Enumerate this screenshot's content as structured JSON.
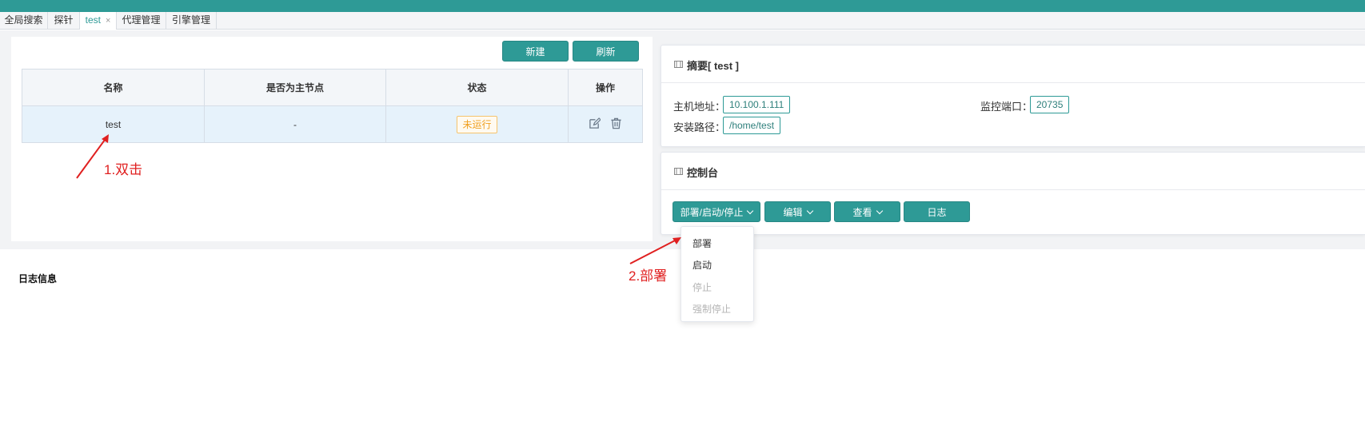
{
  "tabs": [
    {
      "label": "全局搜索"
    },
    {
      "label": "探针"
    },
    {
      "label": "test",
      "close": "×"
    },
    {
      "label": "代理管理"
    },
    {
      "label": "引擎管理"
    }
  ],
  "toolbar": {
    "new_label": "新建",
    "refresh_label": "刷新"
  },
  "table": {
    "columns": [
      "名称",
      "是否为主节点",
      "状态",
      "操作"
    ],
    "rows": [
      {
        "name": "test",
        "is_master": "-",
        "status": "未运行",
        "actions": [
          "edit-icon",
          "delete-icon"
        ]
      }
    ]
  },
  "annotations": {
    "step1": "1.双击",
    "step2": "2.部署"
  },
  "summary": {
    "title": "摘要[ test ]",
    "host_label": "主机地址：",
    "host_value": "10.100.1.111",
    "port_label": "监控端口：",
    "port_value": "20735",
    "path_label": "安装路径：",
    "path_value": "/home/test"
  },
  "console": {
    "title": "控制台",
    "buttons": [
      {
        "label": "部署/启动/停止"
      },
      {
        "label": "编辑"
      },
      {
        "label": "查看"
      },
      {
        "label": "日志"
      }
    ]
  },
  "dropdown": {
    "items": [
      {
        "label": "部署",
        "disabled": false
      },
      {
        "label": "启动",
        "disabled": false
      },
      {
        "label": "停止",
        "disabled": true
      },
      {
        "label": "强制停止",
        "disabled": true
      }
    ]
  },
  "log": {
    "title": "日志信息"
  },
  "colors": {
    "primary": "#2e9a96",
    "warning": "#f0a020",
    "annotation": "#e02020"
  }
}
